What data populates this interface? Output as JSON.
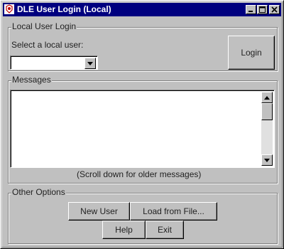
{
  "window": {
    "title": "DLE User Login (Local)",
    "title_bg": "#00007f",
    "icons": [
      "app-icon",
      "minimize-icon",
      "maximize-icon",
      "close-icon"
    ]
  },
  "local_login": {
    "group_title": "Local User Login",
    "select_label": "Select a local user:",
    "selected_user": "",
    "login_button": "Login"
  },
  "messages": {
    "group_title": "Messages",
    "content": "",
    "hint": "(Scroll down for older messages)"
  },
  "other_options": {
    "group_title": "Other Options",
    "new_user": "New User",
    "load_from_file": "Load from File...",
    "help": "Help",
    "exit": "Exit"
  }
}
